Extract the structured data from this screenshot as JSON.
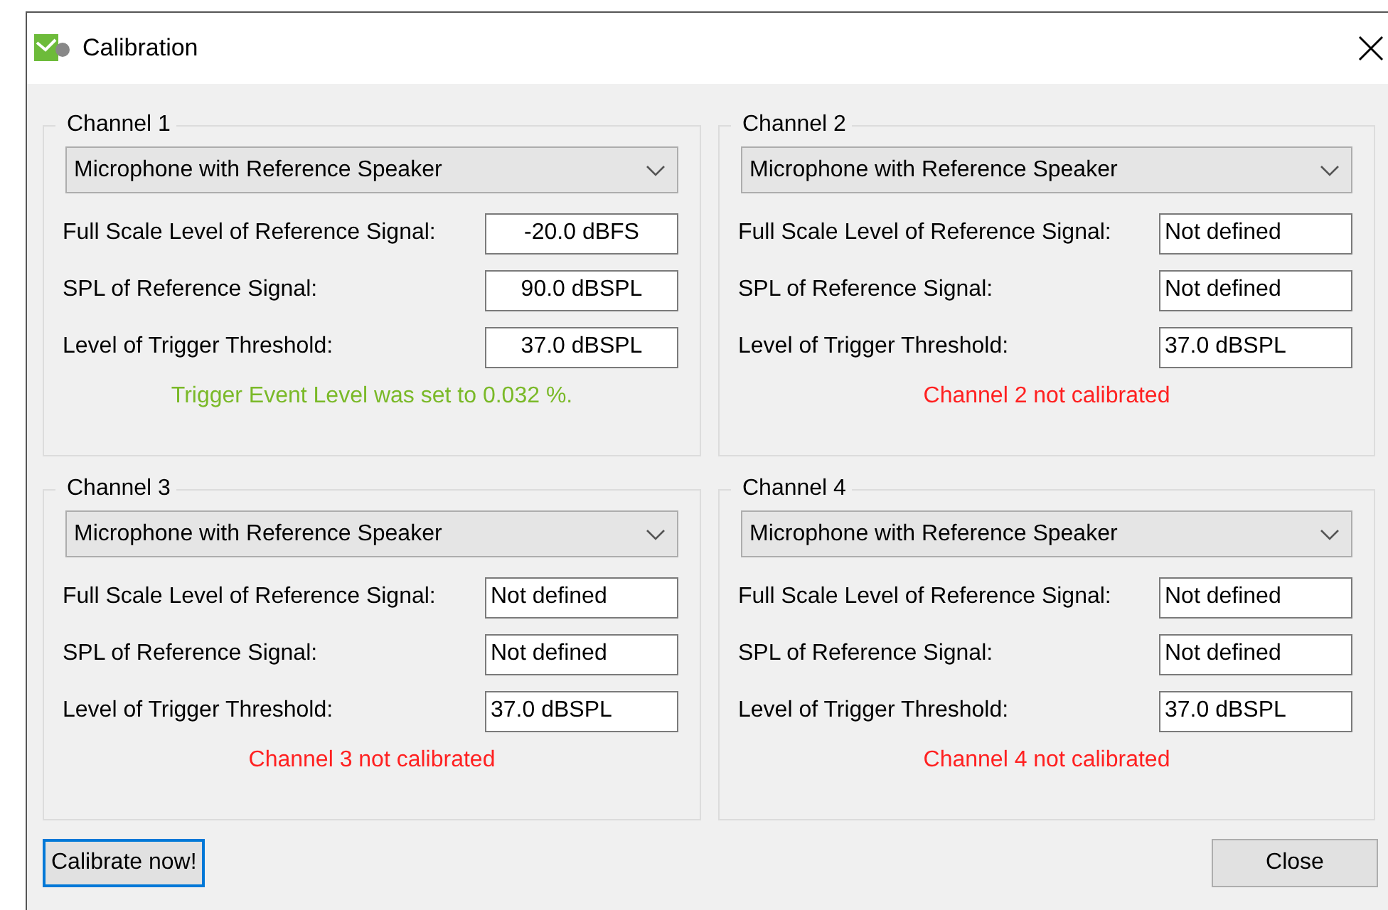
{
  "window": {
    "title": "Calibration"
  },
  "channels": [
    {
      "title": "Channel 1",
      "source": "Microphone with Reference Speaker",
      "fields": [
        {
          "label": "Full Scale Level of Reference Signal:",
          "value": "-20.0 dBFS",
          "centered": true
        },
        {
          "label": "SPL of Reference Signal:",
          "value": "90.0 dBSPL",
          "centered": true
        },
        {
          "label": "Level of Trigger Threshold:",
          "value": "37.0 dBSPL",
          "centered": true
        }
      ],
      "status": {
        "text": "Trigger Event Level was set to 0.032 %.",
        "color": "#7ab928"
      }
    },
    {
      "title": "Channel 2",
      "source": "Microphone with Reference Speaker",
      "fields": [
        {
          "label": "Full Scale Level of Reference Signal:",
          "value": "Not defined",
          "centered": false
        },
        {
          "label": "SPL of Reference Signal:",
          "value": "Not defined",
          "centered": false
        },
        {
          "label": "Level of Trigger Threshold:",
          "value": "37.0 dBSPL",
          "centered": false
        }
      ],
      "status": {
        "text": "Channel 2 not calibrated",
        "color": "#ff2020"
      }
    },
    {
      "title": "Channel 3",
      "source": "Microphone with Reference Speaker",
      "fields": [
        {
          "label": "Full Scale Level of Reference Signal:",
          "value": "Not defined",
          "centered": false
        },
        {
          "label": "SPL of Reference Signal:",
          "value": "Not defined",
          "centered": false
        },
        {
          "label": "Level of Trigger Threshold:",
          "value": "37.0 dBSPL",
          "centered": false
        }
      ],
      "status": {
        "text": "Channel 3 not calibrated",
        "color": "#ff2020"
      }
    },
    {
      "title": "Channel 4",
      "source": "Microphone with Reference Speaker",
      "fields": [
        {
          "label": "Full Scale Level of Reference Signal:",
          "value": "Not defined",
          "centered": false
        },
        {
          "label": "SPL of Reference Signal:",
          "value": "Not defined",
          "centered": false
        },
        {
          "label": "Level of Trigger Threshold:",
          "value": "37.0 dBSPL",
          "centered": false
        }
      ],
      "status": {
        "text": "Channel 4 not calibrated",
        "color": "#ff2020"
      }
    }
  ],
  "buttons": [
    {
      "label": "Calibrate now!",
      "focused": true
    },
    {
      "label": "Close",
      "focused": false
    }
  ]
}
